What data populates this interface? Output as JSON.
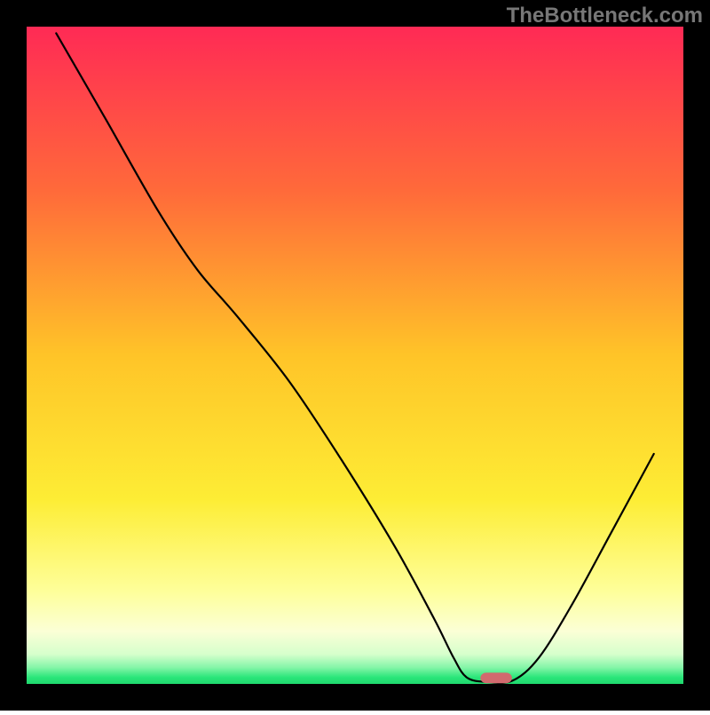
{
  "watermark": "TheBottleneck.com",
  "chart_data": {
    "type": "line",
    "title": "",
    "xlabel": "",
    "ylabel": "",
    "xlim": [
      0,
      100
    ],
    "ylim": [
      0,
      100
    ],
    "gradient_stops": [
      {
        "offset": 0.0,
        "color": "#ff2a55"
      },
      {
        "offset": 0.25,
        "color": "#ff6a3a"
      },
      {
        "offset": 0.5,
        "color": "#ffc428"
      },
      {
        "offset": 0.72,
        "color": "#fded35"
      },
      {
        "offset": 0.86,
        "color": "#feff9b"
      },
      {
        "offset": 0.92,
        "color": "#fbffd6"
      },
      {
        "offset": 0.955,
        "color": "#d6ffcc"
      },
      {
        "offset": 0.975,
        "color": "#84f5a8"
      },
      {
        "offset": 0.99,
        "color": "#2ae67a"
      },
      {
        "offset": 1.0,
        "color": "#1fd86d"
      }
    ],
    "curve": [
      {
        "x": 4.5,
        "y": 99.0
      },
      {
        "x": 12.0,
        "y": 86.0
      },
      {
        "x": 20.0,
        "y": 72.0
      },
      {
        "x": 26.0,
        "y": 63.0
      },
      {
        "x": 32.0,
        "y": 56.0
      },
      {
        "x": 40.0,
        "y": 46.0
      },
      {
        "x": 48.0,
        "y": 34.0
      },
      {
        "x": 56.0,
        "y": 21.0
      },
      {
        "x": 62.0,
        "y": 10.0
      },
      {
        "x": 65.0,
        "y": 4.0
      },
      {
        "x": 67.0,
        "y": 1.0
      },
      {
        "x": 70.0,
        "y": 0.3
      },
      {
        "x": 74.0,
        "y": 0.5
      },
      {
        "x": 78.0,
        "y": 4.0
      },
      {
        "x": 83.0,
        "y": 12.0
      },
      {
        "x": 89.0,
        "y": 23.0
      },
      {
        "x": 95.5,
        "y": 35.0
      }
    ],
    "marker": {
      "x": 71.5,
      "y": 0.9,
      "w": 4.8,
      "h": 1.6,
      "rx": 0.9,
      "fill": "#d16a6e"
    },
    "frame": 30,
    "inner": 740
  }
}
